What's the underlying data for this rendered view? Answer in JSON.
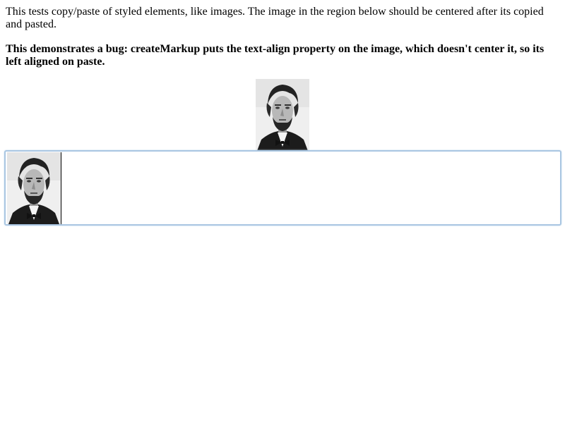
{
  "description": {
    "line1": "This tests copy/paste of styled elements, like images. The image in the region below should be centered after its copied and pasted.",
    "line2": "This demonstrates a bug: createMarkup puts the text-align property on the image, which doesn't center it, so its left aligned on paste."
  },
  "colors": {
    "editable_border": "#a9c6e2",
    "text": "#000000",
    "background": "#ffffff"
  },
  "images": {
    "source": {
      "icon": "abraham-lincoln-portrait",
      "alignment": "center"
    },
    "pasted": {
      "icon": "abraham-lincoln-portrait",
      "alignment": "left"
    }
  }
}
